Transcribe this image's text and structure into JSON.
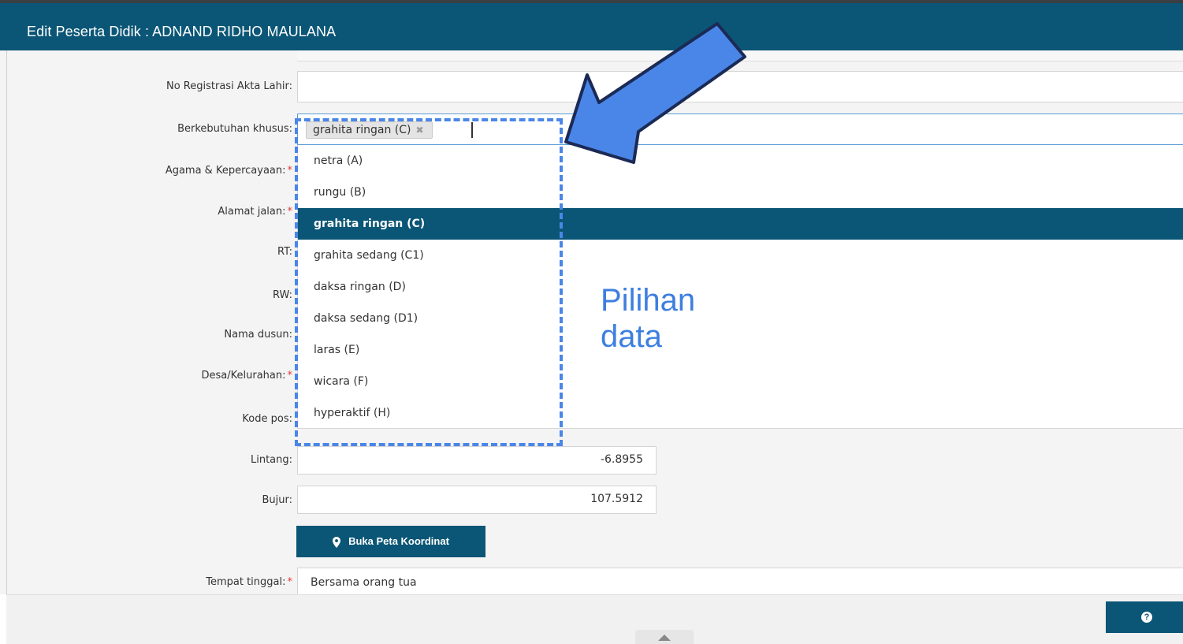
{
  "window": {
    "title": "Edit Peserta Didik : ADNAND RIDHO MAULANA"
  },
  "form": {
    "no_registrasi": {
      "label": "No Registrasi Akta Lahir:",
      "value": ""
    },
    "berkebutuhan": {
      "label": "Berkebutuhan khusus:",
      "selected_chip": "grahita ringan (C)",
      "remove_glyph": "✖"
    },
    "agama": {
      "label": "Agama & Kepercayaan:",
      "required_mark": "*"
    },
    "alamat": {
      "label": "Alamat jalan:",
      "required_mark": "*"
    },
    "rt": {
      "label": "RT:"
    },
    "rw": {
      "label": "RW:"
    },
    "nama_dusun": {
      "label": "Nama dusun:"
    },
    "desa": {
      "label": "Desa/Kelurahan:",
      "required_mark": "*"
    },
    "kode_pos": {
      "label": "Kode pos:"
    },
    "lintang": {
      "label": "Lintang:",
      "value": "-6.8955"
    },
    "bujur": {
      "label": "Bujur:",
      "value": "107.5912"
    },
    "map_button": {
      "label": "Buka Peta Koordinat",
      "icon": "map-marker-icon"
    },
    "tempat_tinggal": {
      "label": "Tempat tinggal:",
      "required_mark": "*",
      "value": "Bersama orang tua"
    }
  },
  "dropdown": {
    "options": [
      "netra (A)",
      "rungu (B)",
      "grahita ringan (C)",
      "grahita sedang (C1)",
      "daksa ringan (D)",
      "daksa sedang (D1)",
      "laras (E)",
      "wicara (F)",
      "hyperaktif (H)"
    ],
    "active_option": "grahita ringan (C)"
  },
  "footer": {
    "help_icon": "question-circle-icon",
    "scroll_icon": "chevron-up-icon"
  },
  "annotation": {
    "label_line1": "Pilihan",
    "label_line2": "data",
    "color": "#4a86e8"
  },
  "colors": {
    "header": "#0b5676",
    "active_option": "#0b5676",
    "required": "#e03b3b",
    "annotation": "#4a86e8"
  }
}
